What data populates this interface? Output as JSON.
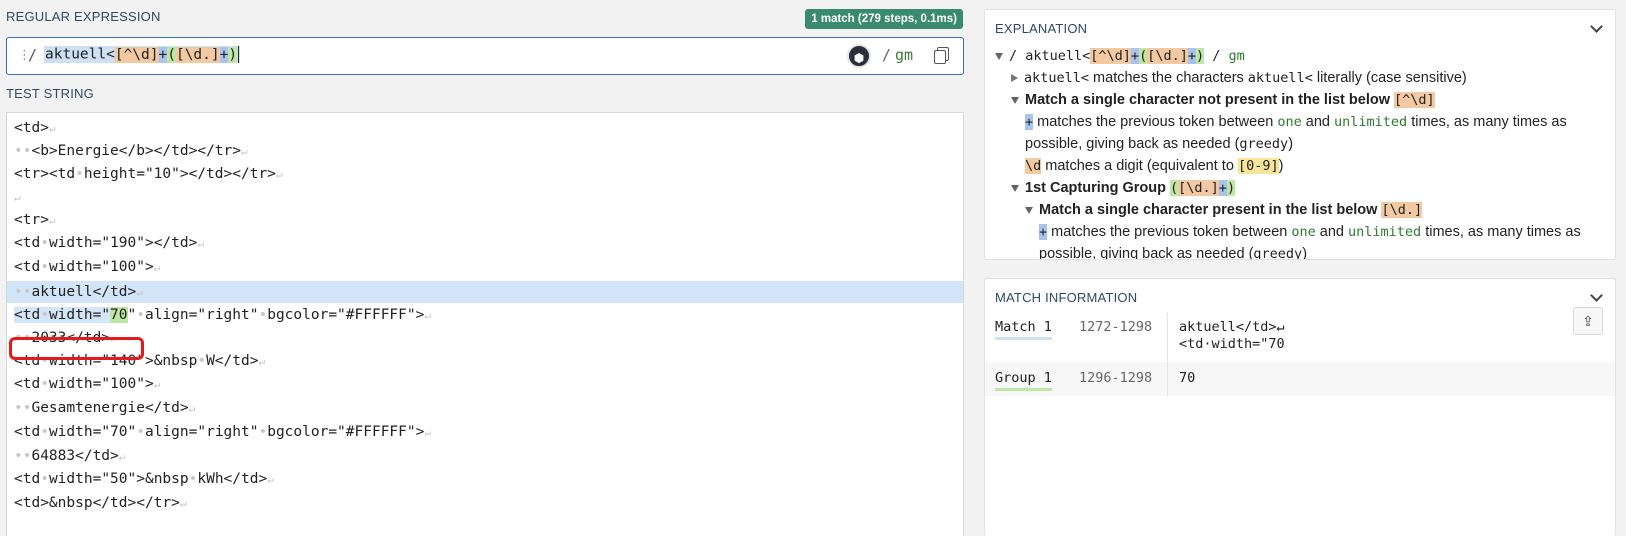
{
  "regex_section": {
    "label": "REGULAR EXPRESSION",
    "match_badge": "1 match (279 steps, 0.1ms)",
    "delimiter_open": "/",
    "pattern_parts": [
      {
        "text": "aktuell<",
        "type": "literal"
      },
      {
        "text": "[^\\d]",
        "type": "bracket"
      },
      {
        "text": "+",
        "type": "quant"
      },
      {
        "text": "(",
        "type": "group"
      },
      {
        "text": "[\\d.]",
        "type": "bracket"
      },
      {
        "text": "+",
        "type": "quant"
      },
      {
        "text": ")",
        "type": "group"
      }
    ],
    "flags": "gm",
    "flags_delimiter": "/",
    "debugger_icon": "regex101-debugger-icon",
    "copy_icon": "copy-icon"
  },
  "test_section": {
    "label": "TEST STRING",
    "lines": [
      "<td>",
      "··<b>Energie</b></td></tr>",
      "<tr><td·height=\"10\"></td></tr>",
      "",
      "<tr>",
      "<td·width=\"190\"></td>",
      "<td·width=\"100\">",
      "··aktuell</td>",
      "<td·width=\"70\"·align=\"right\"·bgcolor=\"#FFFFFF\">",
      "··2033</td>",
      "<td·width=\"140\">&nbsp·W</td>",
      "<td·width=\"100\">",
      "··Gesamtenergie</td>",
      "<td·width=\"70\"·align=\"right\"·bgcolor=\"#FFFFFF\">",
      "··64883</td>",
      "<td·width=\"50\">&nbsp·kWh</td>",
      "<td>&nbsp</td></tr>"
    ]
  },
  "explanation": {
    "title": "EXPLANATION",
    "root_pattern": "/ aktuell<[^\\d]+([\\d.]+) / gm",
    "line_literal_code": "aktuell<",
    "line_literal_text": " matches the characters ",
    "line_literal_code2": "aktuell<",
    "line_literal_tail": " literally (case sensitive)",
    "not_present_title": "Match a single character not present in the list below",
    "not_present_token": "[^\\d]",
    "plus_token": "+",
    "quant_text_a": " matches the previous token between ",
    "quant_one": "one",
    "quant_and": " and ",
    "quant_unlimited": "unlimited",
    "quant_text_b": " times, as many times as",
    "quant_text_c": "possible, giving back as needed (",
    "quant_greedy": "greedy",
    "quant_close": ")",
    "digit_token": "\\d",
    "digit_text": " matches a digit (equivalent to ",
    "digit_equiv": "[0-9]",
    "digit_close": ")",
    "group_title": "1st Capturing Group",
    "group_token": "([\\d.]+)",
    "present_title": "Match a single character present in the list below",
    "present_token": "[\\d.]"
  },
  "match_info": {
    "title": "MATCH INFORMATION",
    "rows": [
      {
        "name": "Match 1",
        "range": "1272-1298",
        "value": "aktuell</td>↵\n<td·width=\"70",
        "underline": "#cfe0f5"
      },
      {
        "name": "Group 1",
        "range": "1296-1298",
        "value": "70",
        "underline": "#bfe6a3"
      }
    ],
    "share_icon": "share-icon"
  }
}
